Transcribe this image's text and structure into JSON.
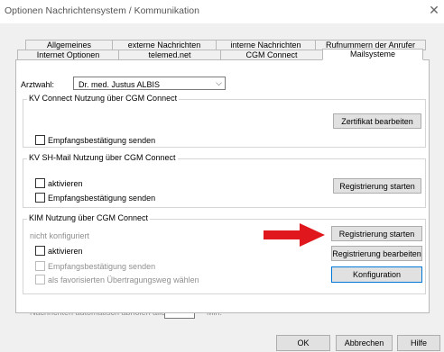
{
  "window": {
    "title": "Optionen Nachrichtensystem / Kommunikation",
    "close_glyph": "✕"
  },
  "tabs": {
    "row1": [
      "Allgemeines",
      "externe Nachrichten",
      "interne Nachrichten",
      "Rufnummern der Anrufer"
    ],
    "row2": [
      "Internet Optionen",
      "telemed.net",
      "CGM Connect",
      "Mailsysteme"
    ],
    "active": "Mailsysteme"
  },
  "arztwahl": {
    "label": "Arztwahl:",
    "selected": "Dr. med. Justus  ALBIS",
    "arrow_glyph": "⌵"
  },
  "kv_connect": {
    "title": "KV Connect Nutzung über CGM Connect",
    "zertifikat_button": "Zertifikat bearbeiten",
    "empfang_label": "Empfangsbestätigung senden"
  },
  "kv_sh_mail": {
    "title": "KV SH-Mail Nutzung über CGM Connect",
    "aktivieren_label": "aktivieren",
    "empfang_label": "Empfangsbestätigung senden",
    "registrierung_button": "Registrierung starten"
  },
  "kim": {
    "title": "KIM Nutzung über CGM Connect",
    "status": "nicht konfiguriert",
    "aktivieren_label": "aktivieren",
    "empfang_label": "Empfangsbestätigung senden",
    "favorit_label": "als favorisierten Übertragungsweg wählen",
    "registrierung_button": "Registrierung starten",
    "registrierung_bearbeiten_button": "Registrierung bearbeiten",
    "konfiguration_button": "Konfiguration"
  },
  "auto_fetch": {
    "label": "Nachrichten automatisch abholen alle",
    "value": "",
    "unit": "Min."
  },
  "footer": {
    "ok": "OK",
    "abbrechen": "Abbrechen",
    "hilfe": "Hilfe"
  },
  "colors": {
    "annotation_arrow": "#e0171c",
    "dialog_background": "#f0f0f0",
    "panel_background": "#ffffff",
    "default_button_border": "#0078d7"
  },
  "icons": {
    "close": "close-icon",
    "dropdown": "chevron-down-icon",
    "annotation": "red-arrow-icon"
  }
}
